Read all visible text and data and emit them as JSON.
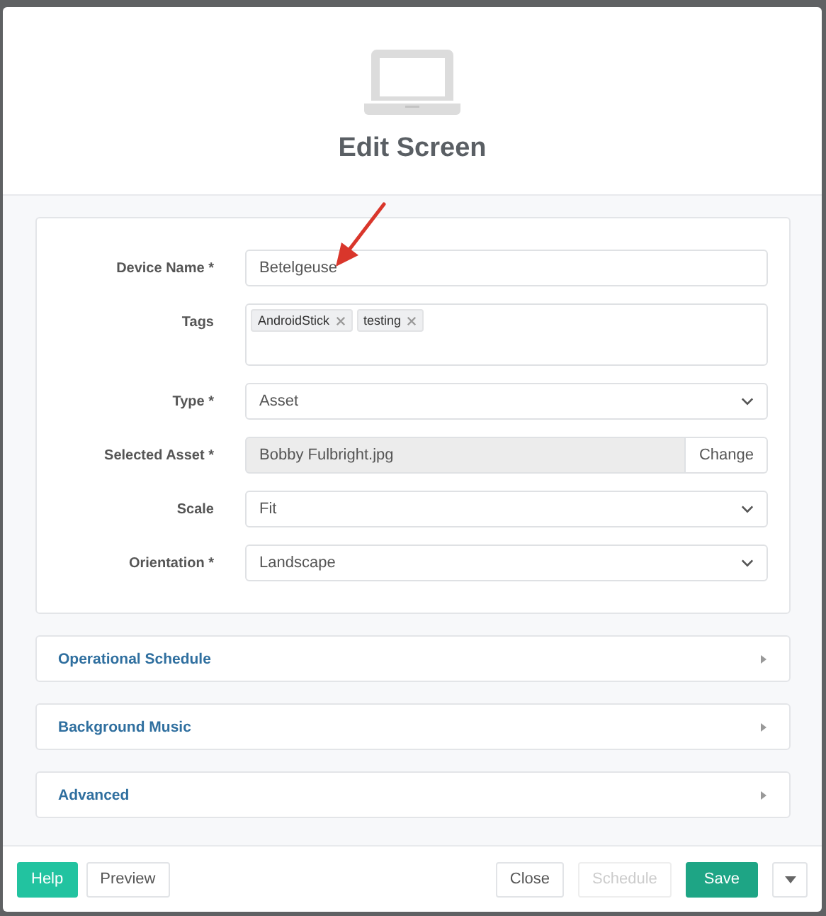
{
  "dialog": {
    "title": "Edit Screen"
  },
  "form": {
    "fields": [
      {
        "kind": "text",
        "label": "Device Name *",
        "value": "Betelgeuse"
      },
      {
        "kind": "tags",
        "label": "Tags",
        "tags": [
          "AndroidStick",
          "testing"
        ]
      },
      {
        "kind": "select",
        "label": "Type *",
        "value": "Asset"
      },
      {
        "kind": "asset",
        "label": "Selected Asset *",
        "value": "Bobby Fulbright.jpg",
        "button": "Change"
      },
      {
        "kind": "select",
        "label": "Scale",
        "value": "Fit"
      },
      {
        "kind": "select",
        "label": "Orientation *",
        "value": "Landscape"
      }
    ]
  },
  "sections": [
    {
      "title": "Operational Schedule",
      "expanded": false
    },
    {
      "title": "Background Music",
      "expanded": false
    },
    {
      "title": "Advanced",
      "expanded": false
    }
  ],
  "footer": {
    "left": [
      {
        "kind": "accent",
        "label": "Help",
        "disabled": false
      },
      {
        "kind": "plain",
        "label": "Preview",
        "disabled": false
      }
    ],
    "right": [
      {
        "kind": "plain",
        "label": "Close",
        "disabled": false
      },
      {
        "kind": "plain",
        "label": "Schedule",
        "disabled": true
      },
      {
        "kind": "primary",
        "label": "Save",
        "disabled": false
      },
      {
        "kind": "dropdown",
        "disabled": false
      }
    ]
  }
}
